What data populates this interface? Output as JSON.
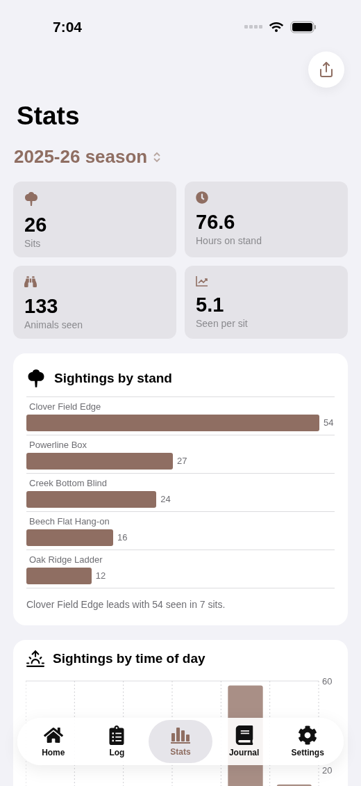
{
  "status_bar": {
    "time": "7:04"
  },
  "title": "Stats",
  "season": {
    "label": "2025-26 season"
  },
  "stat_cards": [
    {
      "kind": "tree",
      "value": "26",
      "label": "Sits"
    },
    {
      "kind": "clock",
      "value": "76.6",
      "label": "Hours on stand"
    },
    {
      "kind": "binoculars",
      "value": "133",
      "label": "Animals seen"
    },
    {
      "kind": "trend",
      "value": "5.1",
      "label": "Seen per sit"
    }
  ],
  "stand_card": {
    "title": "Sightings by stand",
    "rows": [
      {
        "name": "Clover Field Edge",
        "level": 1,
        "count": "54"
      },
      {
        "name": "Powerline Box",
        "level": 0.5,
        "count": "27"
      },
      {
        "name": "Creek Bottom Blind",
        "level": 0.444,
        "count": "24"
      },
      {
        "name": "Beech Flat Hang-on",
        "level": 0.296,
        "count": "16"
      },
      {
        "name": "Oak Ridge Ladder",
        "level": 0.222,
        "count": "12"
      }
    ],
    "summary": "Clover Field Edge leads with 54 seen in 7 sits."
  },
  "time_card": {
    "title": "Sightings by time of day",
    "chart_data": {
      "type": "bar",
      "values": [
        null,
        null,
        0,
        0,
        58,
        13.5
      ],
      "ylim": [
        0,
        60
      ],
      "yticks": [
        20,
        60
      ]
    }
  },
  "tab_bar": [
    {
      "kind": "home",
      "label": "Home",
      "selected": false
    },
    {
      "kind": "log",
      "label": "Log",
      "selected": false
    },
    {
      "kind": "stats",
      "label": "Stats",
      "selected": true
    },
    {
      "kind": "journal",
      "label": "Journal",
      "selected": false
    },
    {
      "kind": "settings",
      "label": "Settings",
      "selected": false
    }
  ]
}
